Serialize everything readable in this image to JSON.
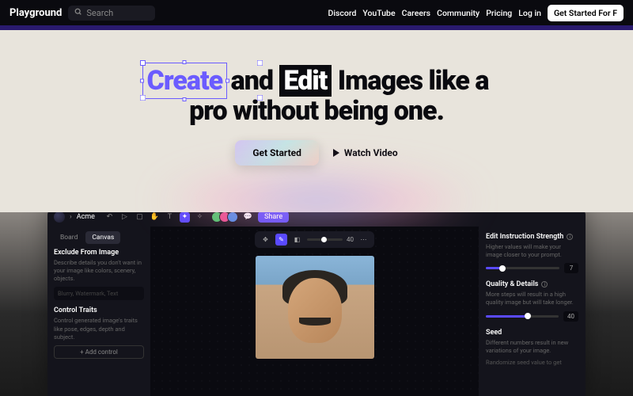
{
  "topbar": {
    "brand": "Playground",
    "search_placeholder": "Search",
    "links": [
      "Discord",
      "YouTube",
      "Careers",
      "Community",
      "Pricing",
      "Log in"
    ],
    "cta": "Get Started For F"
  },
  "hero": {
    "word_create": "Create",
    "word_and": " and ",
    "word_edit": "Edit",
    "rest_line1": " Images like a",
    "line2": "pro without being one.",
    "get_started": "Get Started",
    "watch_video": "Watch Video"
  },
  "app": {
    "crumb_root": "⚪",
    "crumb_sep": "›",
    "crumb_current": "Acme",
    "share": "Share",
    "left": {
      "tabs": [
        "Board",
        "Canvas"
      ],
      "active_tab": 1,
      "exclude_title": "Exclude From Image",
      "exclude_desc": "Describe details you don't want in your image like colors, scenery, objects.",
      "exclude_placeholder": "Blurry, Watermark, Text",
      "control_title": "Control Traits",
      "control_desc": "Control generated image's traits like pose, edges, depth and subject.",
      "add_control": "+ Add control"
    },
    "floatbar": {
      "value": "40"
    },
    "right": {
      "strength_title": "Edit Instruction Strength",
      "strength_desc": "Higher values will make your image closer to your prompt.",
      "strength_val": "7",
      "strength_pct": 20,
      "quality_title": "Quality & Details",
      "quality_desc": "More steps will result in a high quality image but will take longer.",
      "quality_val": "40",
      "quality_pct": 55,
      "seed_title": "Seed",
      "seed_desc": "Different numbers result in new variations of your image.",
      "randomize": "Randomize seed value to get"
    }
  }
}
